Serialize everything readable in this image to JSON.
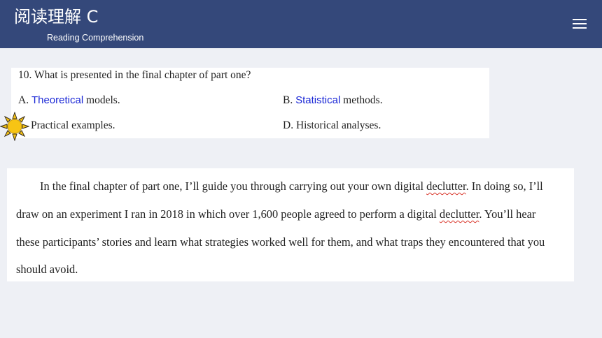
{
  "header": {
    "title": "阅读理解 C",
    "subtitle": "Reading Comprehension",
    "menu_icon": "hamburger-menu-icon"
  },
  "question": {
    "stem": "10. What is presented in the final chapter of part one?",
    "options": {
      "a": {
        "prefix": "A. ",
        "highlight": "Theoretical",
        "rest": " models."
      },
      "b": {
        "prefix": "B. ",
        "highlight": "Statistical",
        "rest": " methods."
      },
      "c": {
        "text": "Practical examples."
      },
      "d": {
        "text": "D. Historical analyses."
      }
    },
    "answer_marker_icon": "sun-icon",
    "accent_color": "#1a27d6"
  },
  "passage": {
    "l1_a": "In the final chapter of part one, I’ll guide you through carrying out your own digital ",
    "l1_word": "declutter",
    "l1_b": ". In doing so, I’ll",
    "l2_a": "draw on an experiment I ran in 2018 in which over 1,600 people agreed to perform a digital ",
    "l2_word": "declutter",
    "l2_b": ". You’ll hear",
    "l3": "these participants’ stories and learn what strategies worked well for them, and what traps they encountered that you",
    "l4": "should avoid."
  },
  "colors": {
    "header_bg": "#34487a",
    "page_bg": "#eef0f5",
    "spellcheck": "#d9362b",
    "sun": "#f7c414"
  }
}
